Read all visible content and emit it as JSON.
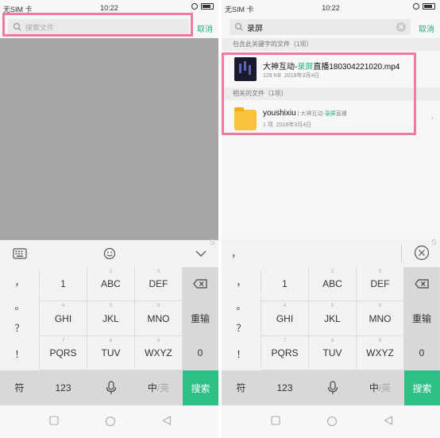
{
  "status": {
    "carrier": "无SIM 卡",
    "time": "10:22"
  },
  "search": {
    "placeholder": "搜索文件",
    "query": "录屏",
    "cancel": "取消"
  },
  "results": {
    "section_keyword": "包含此关键字的文件（1项）",
    "file": {
      "name_prefix": "大神互动-",
      "name_highlight": "录屏",
      "name_suffix": "直播180304221020.mp4",
      "size": "128 KB",
      "date": "2018年3月4日"
    },
    "section_related": "相关的文件（1项）",
    "folder": {
      "name": "youshixiu",
      "path_prefix": " | 大神互动-",
      "path_highlight": "录屏",
      "path_suffix": "直播",
      "count": "1 项",
      "date": "2018年3月4日"
    }
  },
  "keyboard_right_toolbar": {
    "punct": "，"
  },
  "keyboard": {
    "punct": [
      "，",
      "。",
      "？",
      "！"
    ],
    "keys": [
      {
        "main": "1",
        "sup": ""
      },
      {
        "main": "ABC",
        "sup": "2"
      },
      {
        "main": "DEF",
        "sup": "3"
      },
      {
        "main": "GHI",
        "sup": "4"
      },
      {
        "main": "JKL",
        "sup": "5"
      },
      {
        "main": "MNO",
        "sup": "6"
      },
      {
        "main": "PQRS",
        "sup": "7"
      },
      {
        "main": "TUV",
        "sup": "8"
      },
      {
        "main": "WXYZ",
        "sup": "9"
      }
    ],
    "reinput": "重输",
    "zero": "0",
    "symbols": "符",
    "num": "123",
    "lang_main": "中",
    "lang_alt": "/英",
    "search": "搜索"
  },
  "colors": {
    "accent": "#2cbf86",
    "highlight_border": "#f07aa3"
  }
}
